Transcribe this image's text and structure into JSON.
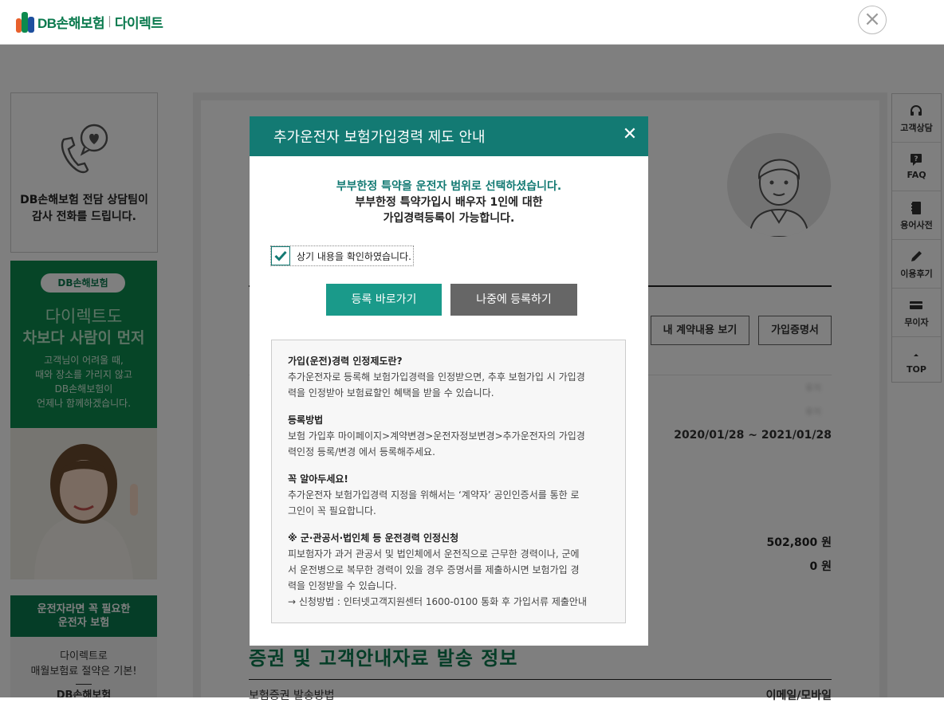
{
  "header": {
    "logo_brand": "DB손해보험",
    "logo_sub": "다이렉트",
    "close_symbol": "×"
  },
  "left_ads": {
    "call_text_1": "DB손해보험 전담 상담팀이",
    "call_text_2": "감사 전화를 드립니다.",
    "green_pill": "DB손해보험",
    "green_h1": "다이렉트도",
    "green_h2": "차보다 사람이 먼저",
    "green_body_1": "고객님이 어려울 때,",
    "green_body_2": "때와 장소를 가리지 않고",
    "green_body_3": "DB손해보험이",
    "green_body_4": "언제나 함께하겠습니다.",
    "card_top_1": "운전자라면 꼭 필요한",
    "card_top_2": "운전자 보험",
    "card_mid_1": "다이렉트로",
    "card_mid_2": "매월보험료 절약은 기본!",
    "card_bottom": "DB손해보험"
  },
  "main": {
    "btn_contract": "내 계약내용 보기",
    "btn_certificate": "가입증명서",
    "blurred_1": "유지",
    "blurred_2": "유지",
    "period": "2020/01/28 ~ 2021/01/28",
    "premium": "502,800 원",
    "discount": "0 원",
    "section_title": "증권 및 고객안내자료 발송 정보",
    "row_label": "보험증권 발송방법",
    "row_value": "이메일/모바일"
  },
  "quick_menu": [
    {
      "label": "고객상담",
      "icon": "headset-icon"
    },
    {
      "label": "FAQ",
      "icon": "faq-icon"
    },
    {
      "label": "용어사전",
      "icon": "dictionary-icon"
    },
    {
      "label": "이용후기",
      "icon": "pencil-icon"
    },
    {
      "label": "무이자",
      "icon": "card-icon"
    },
    {
      "label": "TOP",
      "icon": "arrow-up-icon"
    }
  ],
  "modal": {
    "title": "추가운전자 보험가입경력 제도 안내",
    "close": "✕",
    "intro_1": "부부한정 특약을 운전자 범위로 선택하셨습니다.",
    "intro_2": "부부한정 특약가입시 배우자 1인에 대한",
    "intro_3": "가입경력등록이 가능합니다.",
    "confirm_label": "상기 내용을 확인하였습니다.",
    "confirm_checked": true,
    "btn_register": "등록 바로가기",
    "btn_later": "나중에 등록하기",
    "info": {
      "s1_title": "가입(운전)경력 인정제도란?",
      "s1_l1": "추가운전자로 등록해 보험가입경력을 인정받으면, 추후 보험가입 시 가입경",
      "s1_l2": "력을 인정받아 보험료할인 혜택을 받을 수 있습니다.",
      "s2_title": "등록방법",
      "s2_l1": "보험 가입후 마이페이지>계약변경>운전자정보변경>추가운전자의 가입경",
      "s2_l2": "력인정 등록/변경 에서 등록해주세요.",
      "s3_title": "꼭 알아두세요!",
      "s3_l1": "추가운전자 보험가입경력 지정을 위해서는 ‘계약자’ 공인인증서를 통한 로",
      "s3_l2": "그인이 꼭 필요합니다.",
      "s4_title": "※ 군·관공서·법인체 등 운전경력 인정신청",
      "s4_l1": "피보험자가 과거 관공서 및 법인체에서 운전직으로 근무한 경력이나, 군에",
      "s4_l2": "서 운전병으로 복무한 경력이 있을 경우 증명서를 제출하시면 보험가입 경",
      "s4_l3": "력을 인정받을 수 있습니다.",
      "s4_l4": "→ 신청방법 : 인터넷고객지원센터 1600-0100 통화 후 가입서류 제출안내"
    }
  },
  "colors": {
    "brand_green": "#0b7a4e",
    "modal_teal": "#137a73",
    "primary_button": "#1a9a8a",
    "secondary_button": "#666666"
  }
}
